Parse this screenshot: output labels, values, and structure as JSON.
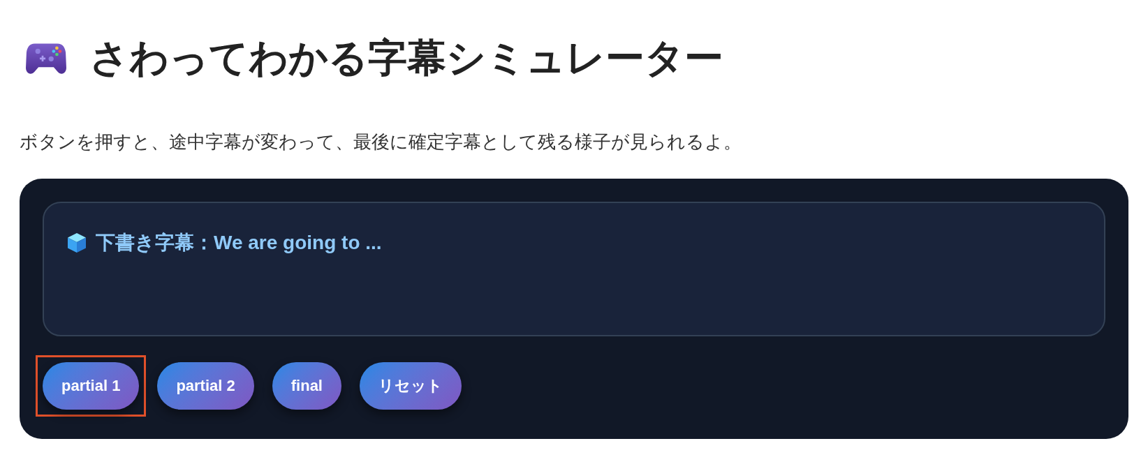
{
  "title": {
    "text": "さわってわかる字幕シミュレーター"
  },
  "description": "ボタンを押すと、途中字幕が変わって、最後に確定字幕として残る様子が見られるよ。",
  "caption": {
    "text": "下書き字幕：We are going to ..."
  },
  "buttons": [
    {
      "label": "partial 1",
      "highlighted": true
    },
    {
      "label": "partial 2",
      "highlighted": false
    },
    {
      "label": "final",
      "highlighted": false
    },
    {
      "label": "リセット",
      "highlighted": false
    }
  ]
}
